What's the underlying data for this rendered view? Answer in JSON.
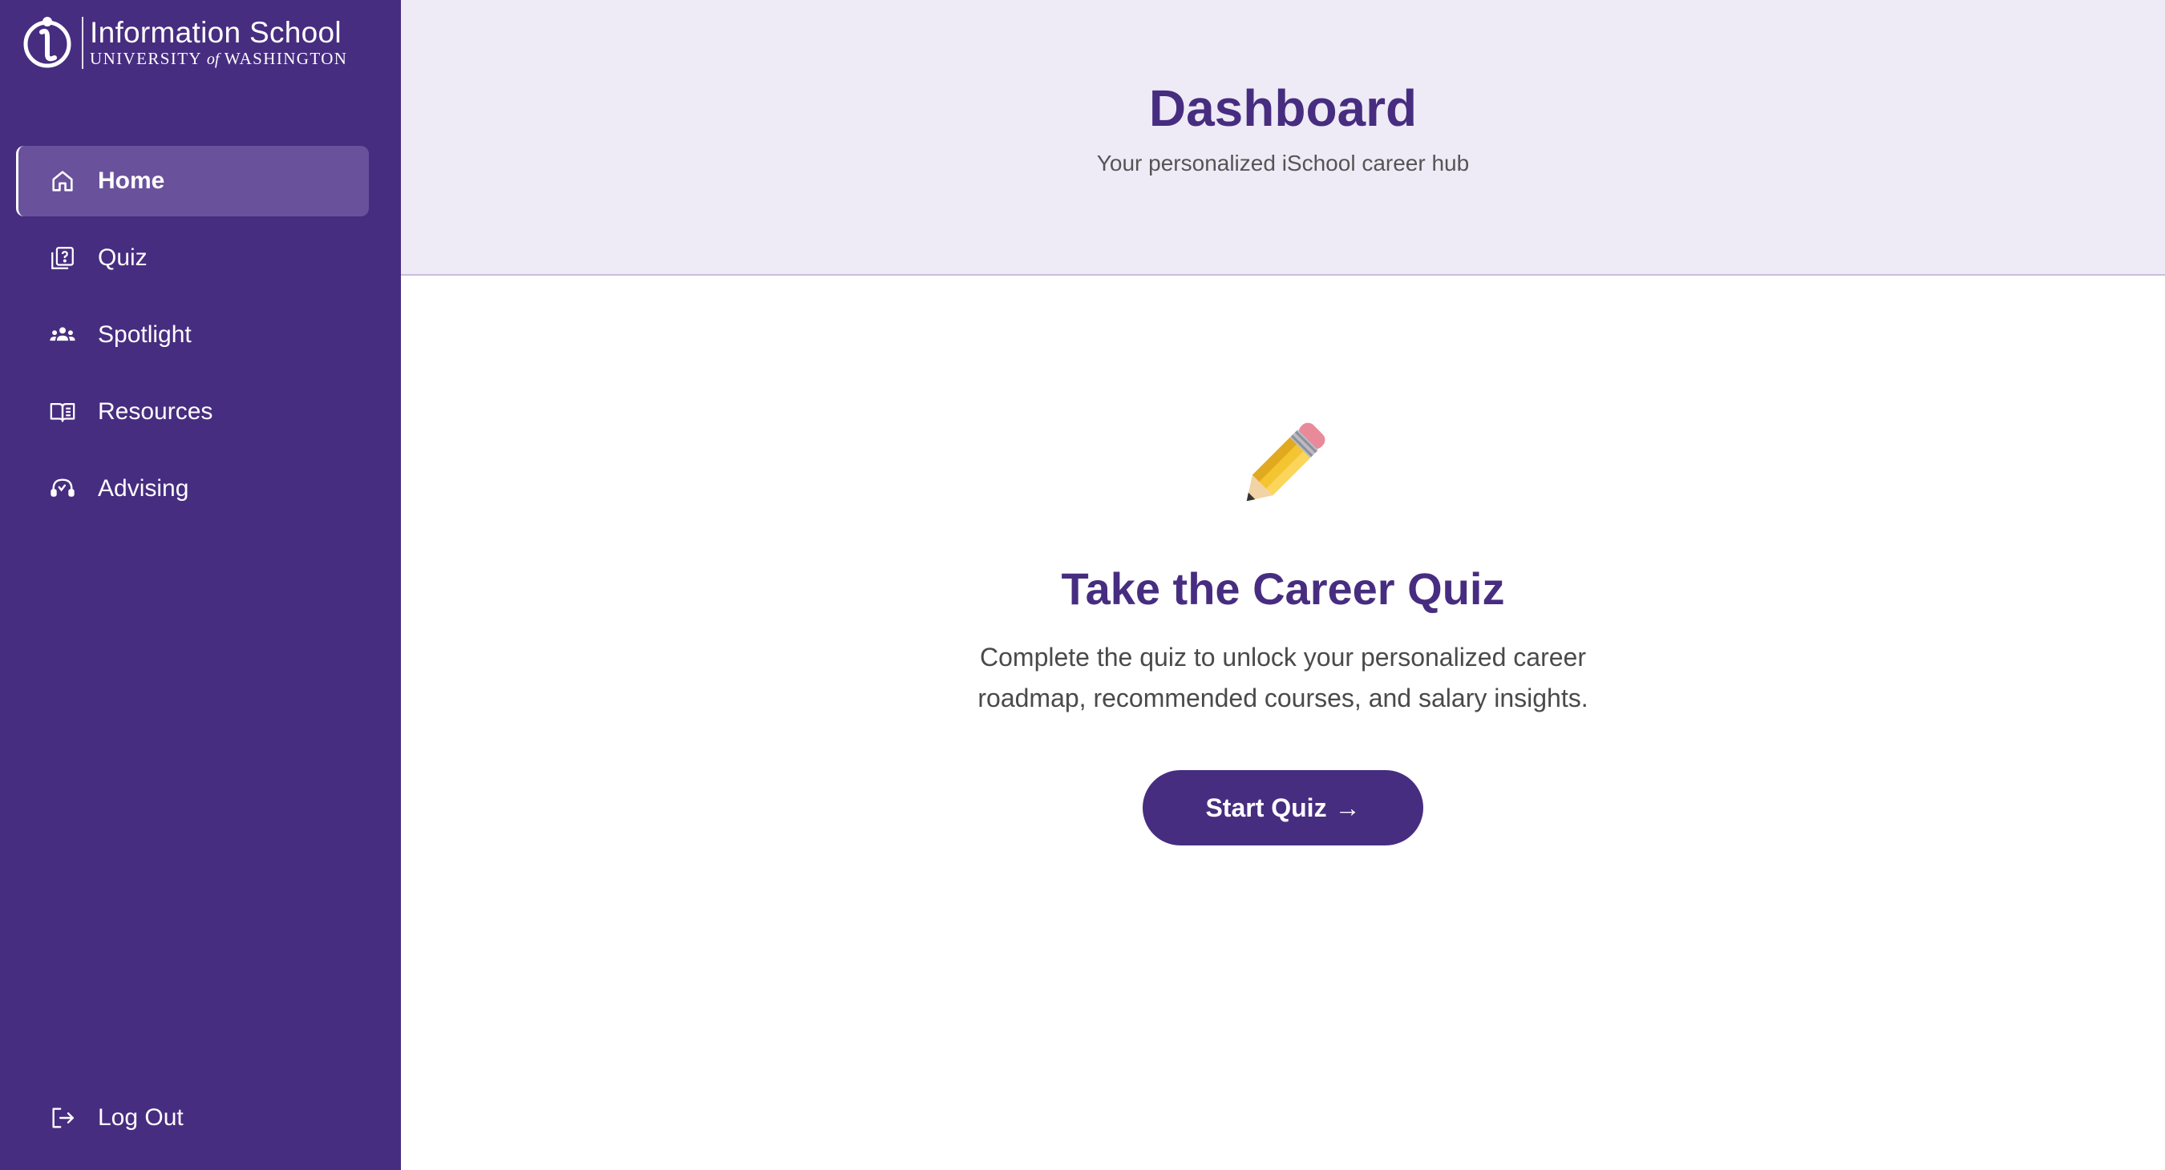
{
  "brand": {
    "title": "Information School",
    "subtitle_part1": "UNIVERSITY",
    "subtitle_of": "of",
    "subtitle_part2": "WASHINGTON"
  },
  "sidebar": {
    "items": [
      {
        "label": "Home",
        "icon": "home-icon",
        "active": true
      },
      {
        "label": "Quiz",
        "icon": "quiz-icon",
        "active": false
      },
      {
        "label": "Spotlight",
        "icon": "people-icon",
        "active": false
      },
      {
        "label": "Resources",
        "icon": "book-icon",
        "active": false
      },
      {
        "label": "Advising",
        "icon": "headset-icon",
        "active": false
      }
    ],
    "logout_label": "Log Out"
  },
  "header": {
    "title": "Dashboard",
    "subtitle": "Your personalized iSchool career hub"
  },
  "quiz_card": {
    "icon": "pencil-icon",
    "title": "Take the Career Quiz",
    "description": "Complete the quiz to unlock your personalized career roadmap, recommended courses, and salary insights.",
    "button_label": "Start Quiz",
    "button_arrow": "→"
  },
  "colors": {
    "sidebar": "#472d80",
    "active_item": "#6a519c",
    "header_bg": "#efebf6",
    "accent": "#472d80"
  }
}
